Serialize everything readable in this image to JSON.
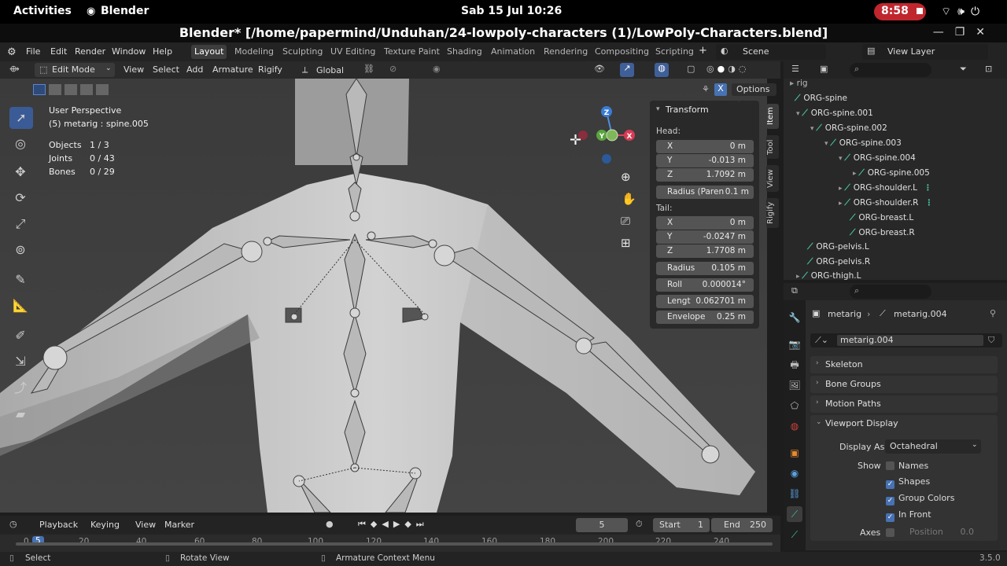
{
  "topbar": {
    "activities": "Activities",
    "app_name": "Blender",
    "clock": "Sab 15 Jul  10:26",
    "record_time": "8:58"
  },
  "window": {
    "title": "Blender* [/home/papermind/Unduhan/24-lowpoly-characters (1)/LowPoly-Characters.blend]"
  },
  "menu": {
    "items": [
      "File",
      "Edit",
      "Render",
      "Window",
      "Help"
    ],
    "workspaces": [
      "Layout",
      "Modeling",
      "Sculpting",
      "UV Editing",
      "Texture Paint",
      "Shading",
      "Animation",
      "Rendering",
      "Compositing",
      "Scripting"
    ],
    "active_workspace": "Layout",
    "scene": "Scene",
    "view_layer": "View Layer"
  },
  "viewport_header": {
    "mode": "Edit Mode",
    "menus": [
      "View",
      "Select",
      "Add",
      "Armature",
      "Rigify"
    ],
    "orientation": "Global",
    "options": "Options",
    "x_mirror": "X"
  },
  "viewport_overlay": {
    "view_name": "User Perspective",
    "active": "(5) metarig : spine.005",
    "stats": [
      {
        "label": "Objects",
        "value": "1 / 3"
      },
      {
        "label": "Joints",
        "value": "0 / 43"
      },
      {
        "label": "Bones",
        "value": "0 / 29"
      }
    ],
    "axes": {
      "z": "Z",
      "y": "Y",
      "x": "X"
    }
  },
  "n_panel": {
    "title": "Transform",
    "head_label": "Head:",
    "head": [
      {
        "label": "X",
        "value": "0 m"
      },
      {
        "label": "Y",
        "value": "-0.013 m"
      },
      {
        "label": "Z",
        "value": "1.7092 m"
      }
    ],
    "radius_parent": {
      "label": "Radius (Paren",
      "value": "0.1 m"
    },
    "tail_label": "Tail:",
    "tail": [
      {
        "label": "X",
        "value": "0 m"
      },
      {
        "label": "Y",
        "value": "-0.0247 m"
      },
      {
        "label": "Z",
        "value": "1.7708 m"
      }
    ],
    "radius": {
      "label": "Radius",
      "value": "0.105 m"
    },
    "roll": {
      "label": "Roll",
      "value": "0.000014°"
    },
    "length": {
      "label": "Lengt",
      "value": "0.062701 m"
    },
    "envelope": {
      "label": "Envelope",
      "value": "0.25 m"
    },
    "tabs": [
      "Item",
      "Tool",
      "View",
      "Rigify"
    ]
  },
  "outliner": {
    "rows": [
      {
        "label": "rig",
        "depth": 0
      },
      {
        "label": "ORG-spine",
        "depth": 1
      },
      {
        "label": "ORG-spine.001",
        "depth": 1
      },
      {
        "label": "ORG-spine.002",
        "depth": 2
      },
      {
        "label": "ORG-spine.003",
        "depth": 3
      },
      {
        "label": "ORG-spine.004",
        "depth": 4
      },
      {
        "label": "ORG-spine.005",
        "depth": 5
      },
      {
        "label": "ORG-shoulder.L",
        "depth": 4
      },
      {
        "label": "ORG-shoulder.R",
        "depth": 4
      },
      {
        "label": "ORG-breast.L",
        "depth": 4
      },
      {
        "label": "ORG-breast.R",
        "depth": 4
      },
      {
        "label": "ORG-pelvis.L",
        "depth": 1
      },
      {
        "label": "ORG-pelvis.R",
        "depth": 1
      },
      {
        "label": "ORG-thigh.L",
        "depth": 1
      }
    ]
  },
  "properties": {
    "breadcrumb_object": "metarig",
    "breadcrumb_data": "metarig.004",
    "data_name": "metarig.004",
    "sections": [
      "Skeleton",
      "Bone Groups",
      "Motion Paths",
      "Viewport Display"
    ],
    "display_as_label": "Display As",
    "display_as_value": "Octahedral",
    "show_label": "Show",
    "names": "Names",
    "shapes": "Shapes",
    "group_colors": "Group Colors",
    "in_front": "In Front",
    "axes_label": "Axes",
    "position_label": "Position",
    "position_value": "0.0"
  },
  "timeline": {
    "menus": [
      "Playback",
      "Keying",
      "View",
      "Marker"
    ],
    "current_frame": "5",
    "start_label": "Start",
    "start": "1",
    "end_label": "End",
    "end": "250",
    "ruler": [
      "0",
      "5",
      "20",
      "40",
      "60",
      "80",
      "100",
      "120",
      "140",
      "160",
      "180",
      "200",
      "220",
      "240"
    ]
  },
  "statusbar": {
    "select": "Select",
    "rotate": "Rotate View",
    "context": "Armature Context Menu",
    "version": "3.5.0"
  }
}
